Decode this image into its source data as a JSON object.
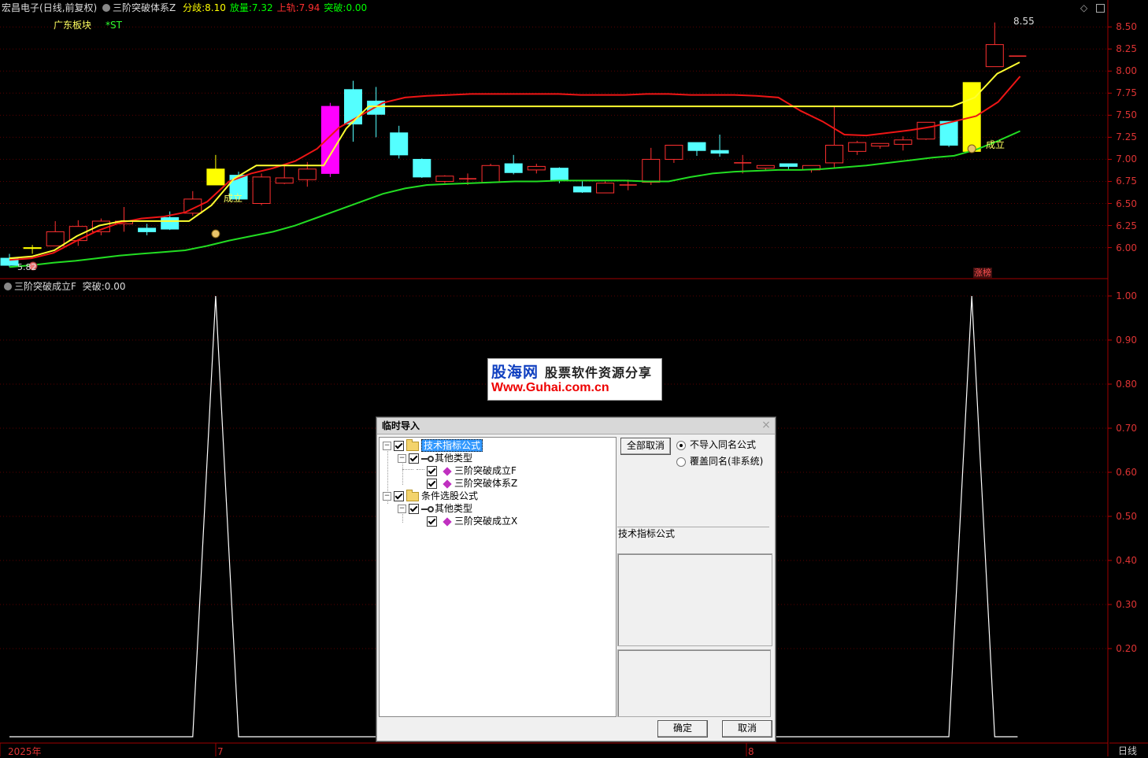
{
  "header": {
    "stock_name": "宏昌电子",
    "period": "(日线,前复权)",
    "indicator_name": "三阶突破体系Z",
    "fields": [
      {
        "label": "分歧:",
        "value": "8.10",
        "color": "#ffff00"
      },
      {
        "label": "放量:",
        "value": "7.32",
        "color": "#00ff00"
      },
      {
        "label": "上轨:",
        "value": "7.94",
        "color": "#ff3030"
      },
      {
        "label": "突破:",
        "value": "0.00",
        "color": "#00ff00"
      }
    ],
    "sector": "广东板块",
    "st_tag": "*ST"
  },
  "top_chart": {
    "price_axis": [
      "8.50",
      "8.25",
      "8.00",
      "7.75",
      "7.50",
      "7.25",
      "7.00",
      "6.75",
      "6.50",
      "6.25",
      "6.00"
    ],
    "ymin": 5.72,
    "ymax": 8.68,
    "high_label": "8.55",
    "low_label": "5.82",
    "signal_text": "成立",
    "limit_up_tag": "涨榜",
    "candles": [
      [
        5.88,
        5.8,
        5.93,
        5.78
      ],
      [
        5.99,
        6.0,
        6.03,
        5.93
      ],
      [
        6.02,
        6.18,
        6.3,
        6.02
      ],
      [
        6.08,
        6.24,
        6.31,
        6.02
      ],
      [
        6.18,
        6.3,
        6.33,
        6.14
      ],
      [
        6.27,
        6.3,
        6.46,
        6.18
      ],
      [
        6.22,
        6.18,
        6.27,
        6.14
      ],
      [
        6.34,
        6.21,
        6.41,
        6.2
      ],
      [
        6.39,
        6.55,
        6.64,
        6.36
      ],
      [
        6.89,
        6.71,
        7.05,
        6.71
      ],
      [
        6.82,
        6.55,
        6.86,
        6.55
      ],
      [
        6.5,
        6.8,
        6.84,
        6.48
      ],
      [
        6.73,
        6.79,
        6.95,
        6.72
      ],
      [
        6.77,
        6.89,
        6.97,
        6.69
      ],
      [
        6.84,
        7.6,
        7.64,
        6.8
      ],
      [
        7.79,
        7.4,
        7.89,
        7.2
      ],
      [
        7.66,
        7.51,
        7.82,
        7.25
      ],
      [
        7.3,
        7.05,
        7.38,
        7.01
      ],
      [
        7.0,
        6.8,
        7.01,
        6.79
      ],
      [
        6.75,
        6.81,
        6.82,
        6.73
      ],
      [
        6.78,
        6.78,
        6.84,
        6.71
      ],
      [
        6.74,
        6.93,
        6.95,
        6.73
      ],
      [
        6.95,
        6.85,
        7.05,
        6.83
      ],
      [
        6.88,
        6.92,
        6.95,
        6.84
      ],
      [
        6.9,
        6.76,
        6.91,
        6.73
      ],
      [
        6.69,
        6.63,
        6.75,
        6.62
      ],
      [
        6.62,
        6.73,
        6.75,
        6.62
      ],
      [
        6.71,
        6.71,
        6.77,
        6.65
      ],
      [
        6.74,
        7.0,
        7.13,
        6.71
      ],
      [
        7.0,
        7.16,
        7.16,
        6.96
      ],
      [
        7.19,
        7.1,
        7.19,
        7.04
      ],
      [
        7.1,
        7.07,
        7.28,
        7.03
      ],
      [
        6.96,
        6.96,
        7.05,
        6.84
      ],
      [
        6.9,
        6.93,
        6.93,
        6.87
      ],
      [
        6.95,
        6.92,
        6.95,
        6.89
      ],
      [
        6.88,
        6.93,
        6.93,
        6.85
      ],
      [
        6.96,
        7.16,
        7.6,
        6.9
      ],
      [
        7.09,
        7.19,
        7.21,
        7.05
      ],
      [
        7.15,
        7.18,
        7.18,
        7.12
      ],
      [
        7.17,
        7.22,
        7.26,
        7.1
      ],
      [
        7.23,
        7.42,
        7.42,
        7.22
      ],
      [
        7.43,
        7.16,
        7.43,
        7.14
      ],
      [
        7.09,
        7.87,
        7.87,
        7.09
      ],
      [
        8.05,
        8.3,
        8.55,
        8.05
      ],
      [
        8.17,
        8.17,
        8.17,
        8.17
      ]
    ],
    "highlight_candles": [
      {
        "index": 1,
        "color": "#ffff00"
      },
      {
        "index": 9,
        "color": "#ffff00"
      },
      {
        "index": 14,
        "color": "#ff00ff"
      },
      {
        "index": 42,
        "color": "#ffff00"
      }
    ],
    "yellow_line": [
      5.88,
      5.9,
      5.97,
      6.13,
      6.25,
      6.3,
      6.3,
      6.3,
      6.3,
      6.48,
      6.78,
      6.93,
      6.93,
      6.93,
      6.93,
      7.35,
      7.6,
      7.6,
      7.6,
      7.6,
      7.6,
      7.6,
      7.6,
      7.6,
      7.6,
      7.6,
      7.6,
      7.6,
      7.6,
      7.6,
      7.6,
      7.6,
      7.6,
      7.6,
      7.6,
      7.6,
      7.6,
      7.6,
      7.6,
      7.6,
      7.6,
      7.6,
      7.6,
      7.7,
      7.97,
      8.1
    ],
    "red_line": [
      5.86,
      5.88,
      5.94,
      6.07,
      6.19,
      6.28,
      6.33,
      6.35,
      6.4,
      6.52,
      6.75,
      6.84,
      6.9,
      6.98,
      7.12,
      7.36,
      7.5,
      7.64,
      7.7,
      7.72,
      7.73,
      7.74,
      7.74,
      7.74,
      7.74,
      7.74,
      7.73,
      7.73,
      7.73,
      7.74,
      7.74,
      7.73,
      7.73,
      7.73,
      7.72,
      7.7,
      7.55,
      7.43,
      7.28,
      7.27,
      7.3,
      7.33,
      7.37,
      7.43,
      7.49,
      7.65,
      7.94
    ],
    "green_line": [
      5.78,
      5.8,
      5.83,
      5.85,
      5.88,
      5.91,
      5.93,
      5.95,
      5.97,
      6.02,
      6.08,
      6.13,
      6.18,
      6.25,
      6.34,
      6.43,
      6.52,
      6.61,
      6.67,
      6.71,
      6.72,
      6.73,
      6.74,
      6.75,
      6.75,
      6.76,
      6.76,
      6.76,
      6.76,
      6.75,
      6.75,
      6.8,
      6.84,
      6.86,
      6.87,
      6.88,
      6.88,
      6.89,
      6.91,
      6.93,
      6.96,
      6.99,
      7.02,
      7.04,
      7.11,
      7.21,
      7.32
    ]
  },
  "sub_chart": {
    "title": "三阶突破成立F",
    "field_label": "突破:",
    "field_value": "0.00",
    "axis": [
      "1.00",
      "0.90",
      "0.80",
      "0.70",
      "0.60",
      "0.50",
      "0.40",
      "0.30",
      "0.20"
    ],
    "signal_values": [
      0,
      0,
      0,
      0,
      0,
      0,
      0,
      0,
      0,
      1,
      0,
      0,
      0,
      0,
      0,
      0,
      0,
      0,
      0,
      0,
      0,
      0,
      0,
      0,
      0,
      0,
      0,
      0,
      0,
      0,
      0,
      0,
      0,
      0,
      0,
      0,
      0,
      0,
      0,
      0,
      0,
      0,
      1,
      0,
      0
    ]
  },
  "time_axis": {
    "start": "2025年",
    "m7": "7",
    "m8": "8"
  },
  "period_button": "日线",
  "watermark": {
    "top": "股海网",
    "tagline": "股票软件资源分享",
    "url": "Www.Guhai.com.cn"
  },
  "dialog": {
    "title": "临时导入",
    "close": "×",
    "tree": {
      "root1": "技术指标公式",
      "group1": "其他类型",
      "item1": "三阶突破成立F",
      "item2": "三阶突破体系Z",
      "root2": "条件选股公式",
      "group2": "其他类型",
      "item3": "三阶突破成立X"
    },
    "cancel_all": "全部取消",
    "radio1": "不导入同名公式",
    "radio2": "覆盖同名(非系统)",
    "info_label": "技术指标公式",
    "ok": "确定",
    "cancel": "取消"
  }
}
